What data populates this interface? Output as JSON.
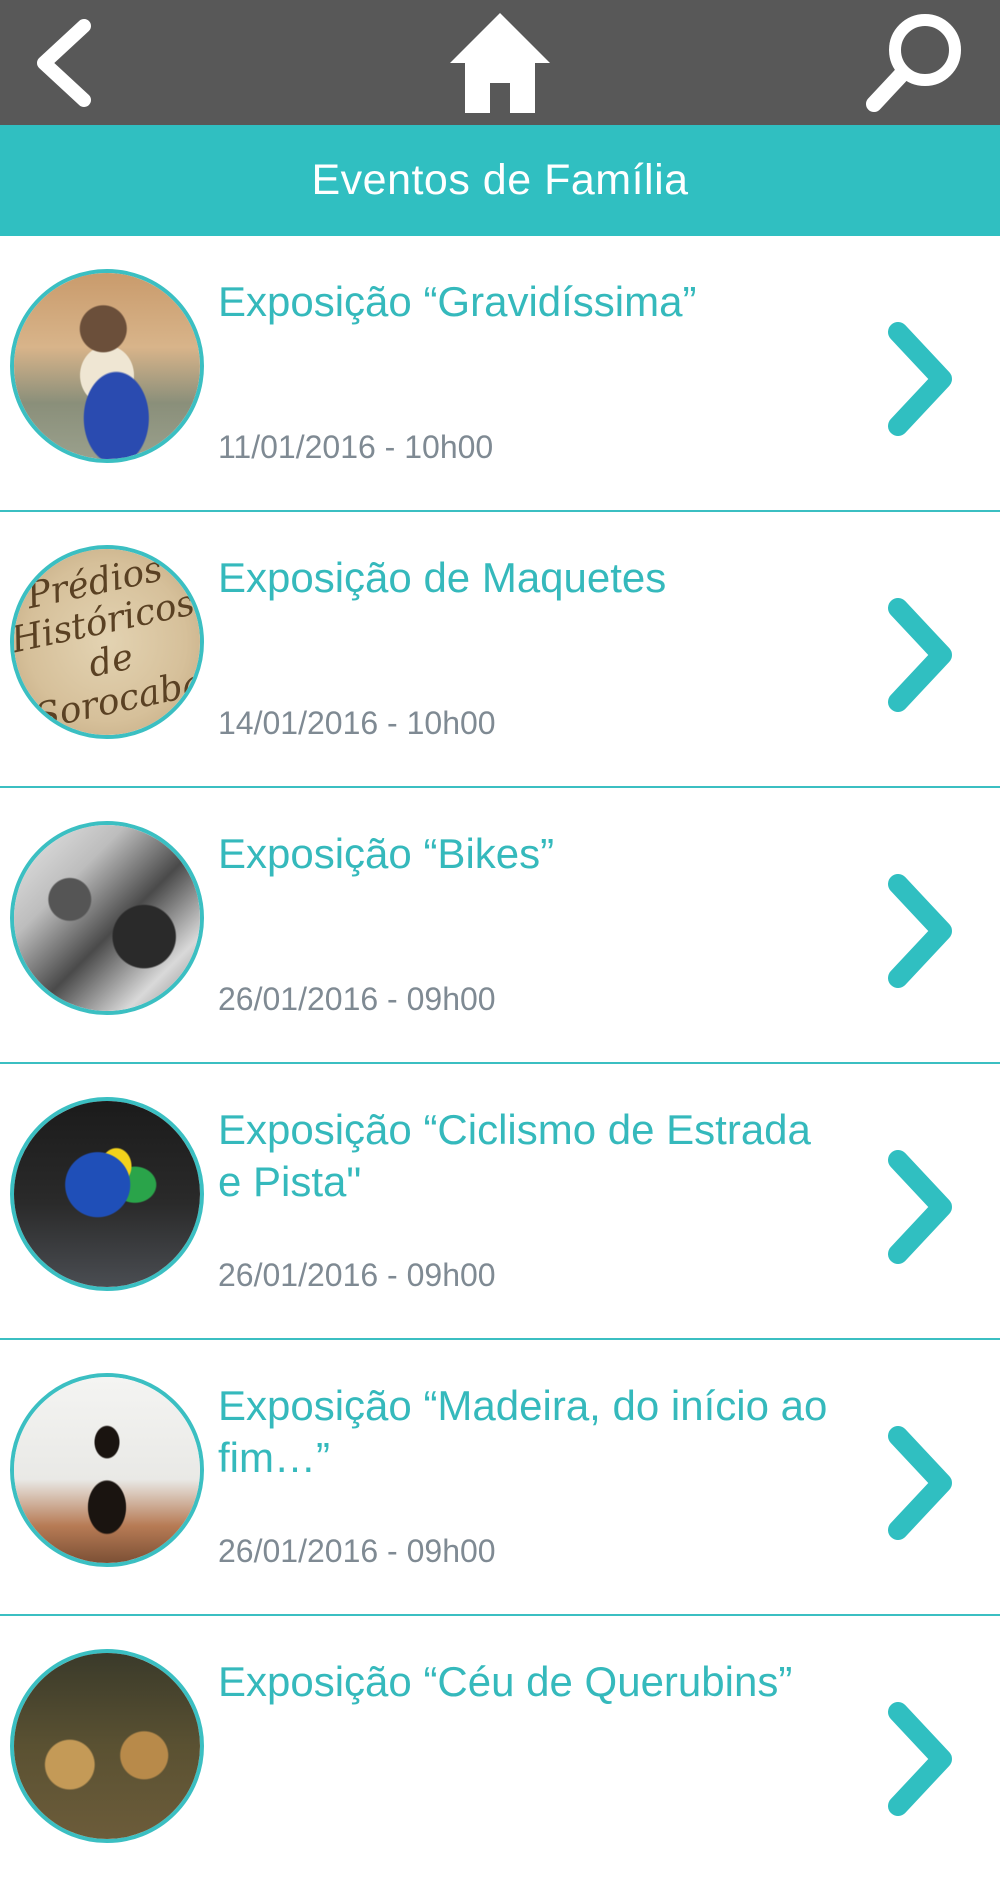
{
  "header": {
    "back_icon": "chevron-left-icon",
    "home_icon": "home-icon",
    "search_icon": "search-icon"
  },
  "section": {
    "title": "Eventos de Família"
  },
  "colors": {
    "topbar": "#585858",
    "accent": "#30bfc1",
    "title_text": "#35b9bc",
    "date_text": "#7f8a93"
  },
  "events": [
    {
      "title": "Exposição “Gravidíssima”",
      "date": "11/01/2016 - 10h00"
    },
    {
      "title": "Exposição de Maquetes",
      "date": "14/01/2016 - 10h00",
      "thumb_text": "Prédios Históricos de Sorocaba"
    },
    {
      "title": "Exposição “Bikes”",
      "date": "26/01/2016 - 09h00"
    },
    {
      "title": "Exposição “Ciclismo de Estrada e Pista\"",
      "date": "26/01/2016 - 09h00"
    },
    {
      "title": "Exposição “Madeira, do início ao fim…”",
      "date": "26/01/2016 - 09h00"
    },
    {
      "title": "Exposição “Céu de Querubins”",
      "date": ""
    }
  ]
}
